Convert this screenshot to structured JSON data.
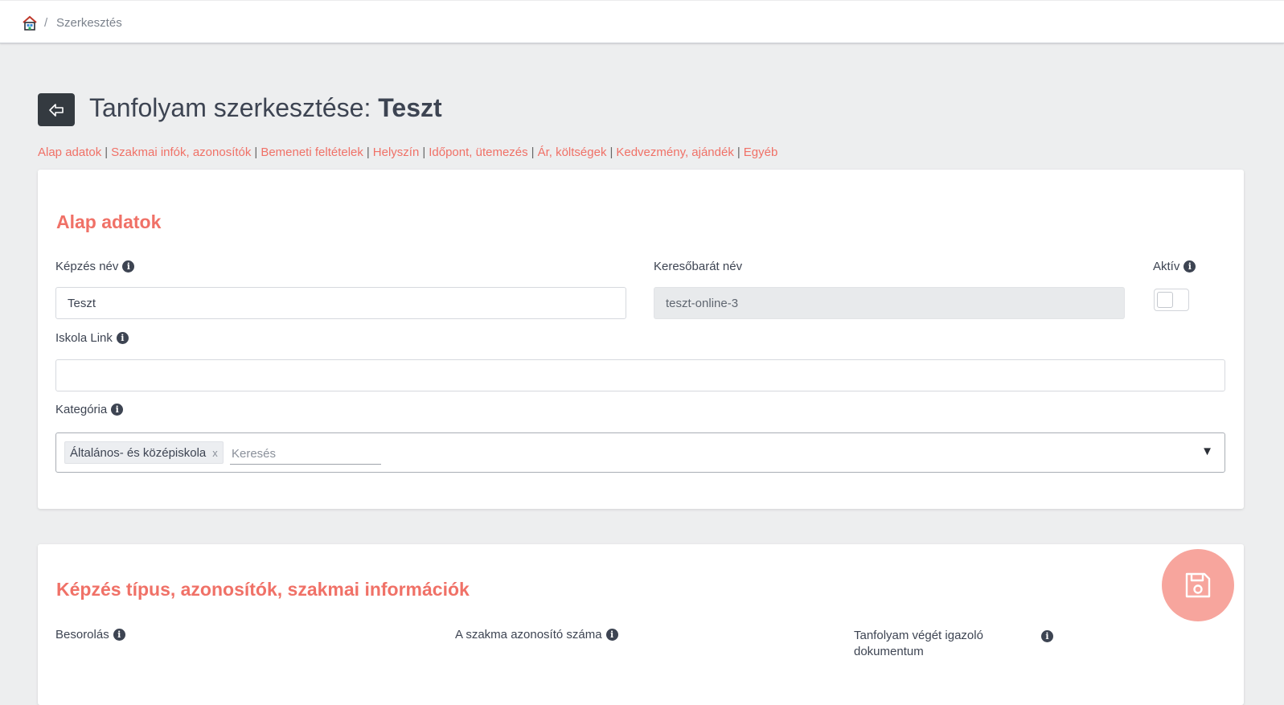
{
  "breadcrumb": {
    "separator": "/",
    "current": "Szerkesztés"
  },
  "page": {
    "title_prefix": "Tanfolyam szerkesztése:",
    "title_name": "Teszt"
  },
  "section_nav": {
    "separator": "|",
    "items": [
      "Alap adatok",
      "Szakmai infók, azonosítók",
      "Bemeneti feltételek",
      "Helyszín",
      "Időpont, ütemezés",
      "Ár, költségek",
      "Kedvezmény, ajándék",
      "Egyéb"
    ]
  },
  "basic": {
    "title": "Alap adatok",
    "name_label": "Képzés név",
    "name_value": "Teszt",
    "slug_label": "Keresőbarát név",
    "slug_value": "teszt-online-3",
    "active_label": "Aktív",
    "school_link_label": "Iskola Link",
    "school_link_value": "",
    "category_label": "Kategória",
    "category_tag": "Általános- és középiskola",
    "tag_remove": "x",
    "category_search_placeholder": "Keresés",
    "caret": "▼"
  },
  "type": {
    "title": "Képzés típus, azonosítók, szakmai információk",
    "classification_label": "Besorolás",
    "profession_id_label": "A szakma azonosító száma",
    "completion_doc_label": "Tanfolyam végét igazoló dokumentum"
  },
  "info_glyph": "i",
  "colors": {
    "accent": "#f07167",
    "fab": "#f7a59d",
    "back_button": "#343a40",
    "text": "#3d4452"
  }
}
